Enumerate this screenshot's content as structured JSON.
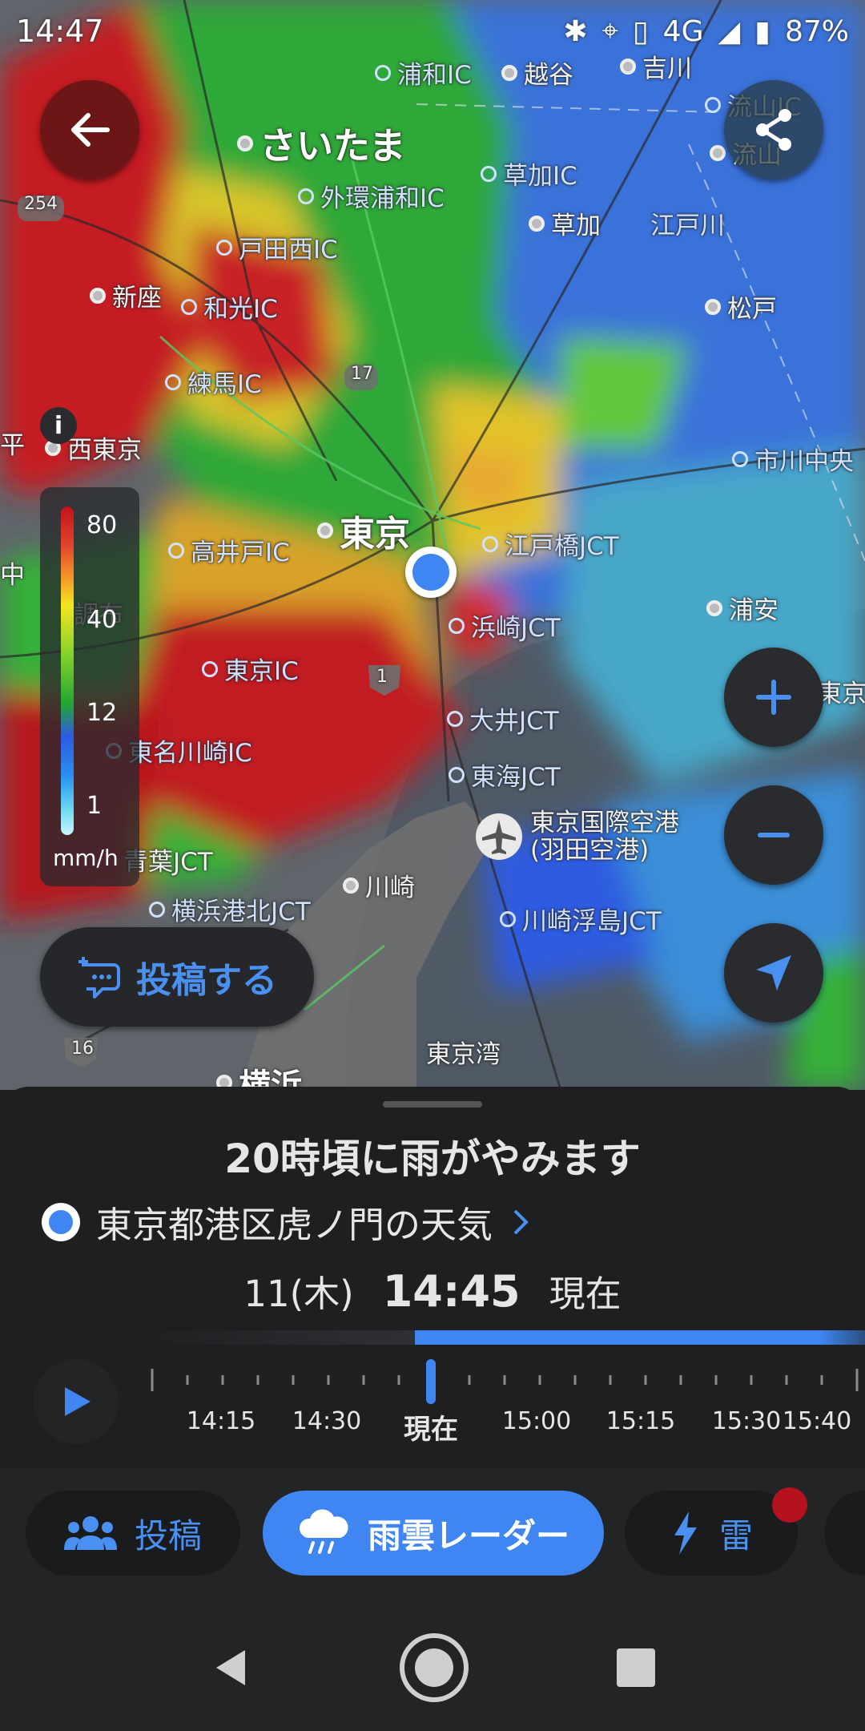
{
  "status_bar": {
    "time": "14:47",
    "network": "4G",
    "battery": "87%"
  },
  "map": {
    "labels": {
      "saitama": "さいたま",
      "urawa_ic": "浦和IC",
      "koshigaya": "越谷",
      "yoshikawa": "吉川",
      "nagareyama_ic": "流山IC",
      "nagareyama": "流山",
      "gaikan_urawa_ic": "外環浦和IC",
      "soka_ic": "草加IC",
      "soka": "草加",
      "edogawa": "江戸川",
      "todanishi_ic": "戸田西IC",
      "niiza": "新座",
      "wako_ic": "和光IC",
      "matsudo": "松戸",
      "nerima_ic": "練馬IC",
      "nishitokyo": "西東京",
      "ichikawachuo": "市川中央",
      "tokyo": "東京",
      "takaido_ic": "高井戸IC",
      "edobashi_jct": "江戸橋JCT",
      "chofu": "調布",
      "hamazaki_jct": "浜崎JCT",
      "urayasu": "浦安",
      "tokyo_ic": "東京IC",
      "oi_jct": "大井JCT",
      "tomei_kawasaki_ic": "東名川崎IC",
      "tokai_jct": "東海JCT",
      "haneda": "東京国際空港\n(羽田空港)",
      "aoba_jct": "青葉JCT",
      "kawasaki": "川崎",
      "yokohamakohoku_jct": "横浜港北JCT",
      "kawasaki_ukishima_jct": "川崎浮島JCT",
      "tokyo_bay": "東京湾",
      "yokohama": "横浜",
      "route_254": "254",
      "route_17": "17",
      "route_1": "1",
      "route_16": "16",
      "left_edge_1": "平",
      "left_edge_2": "中",
      "right_edge_tokyo": "東京"
    },
    "legend": {
      "ticks": [
        "80",
        "40",
        "12",
        "1"
      ],
      "unit": "mm/h"
    },
    "info_label": "i",
    "post_button": "投稿する"
  },
  "sheet": {
    "headline": "20時頃に雨がやみます",
    "location": "東京都港区虎ノ門の天気",
    "date": "11(木)",
    "time": "14:45",
    "now": "現在",
    "timeline_labels": [
      "14:15",
      "14:30",
      "現在",
      "15:00",
      "15:15",
      "15:30",
      "15:40"
    ]
  },
  "tabs": [
    {
      "label": "投稿",
      "icon": "people-icon"
    },
    {
      "label": "雨雲レーダー",
      "icon": "rain-cloud-icon"
    },
    {
      "label": "雷",
      "icon": "lightning-icon"
    }
  ],
  "colors": {
    "accent": "#3f86f2",
    "sheet_bg": "#1e1f21",
    "tab_bg": "#232426"
  }
}
